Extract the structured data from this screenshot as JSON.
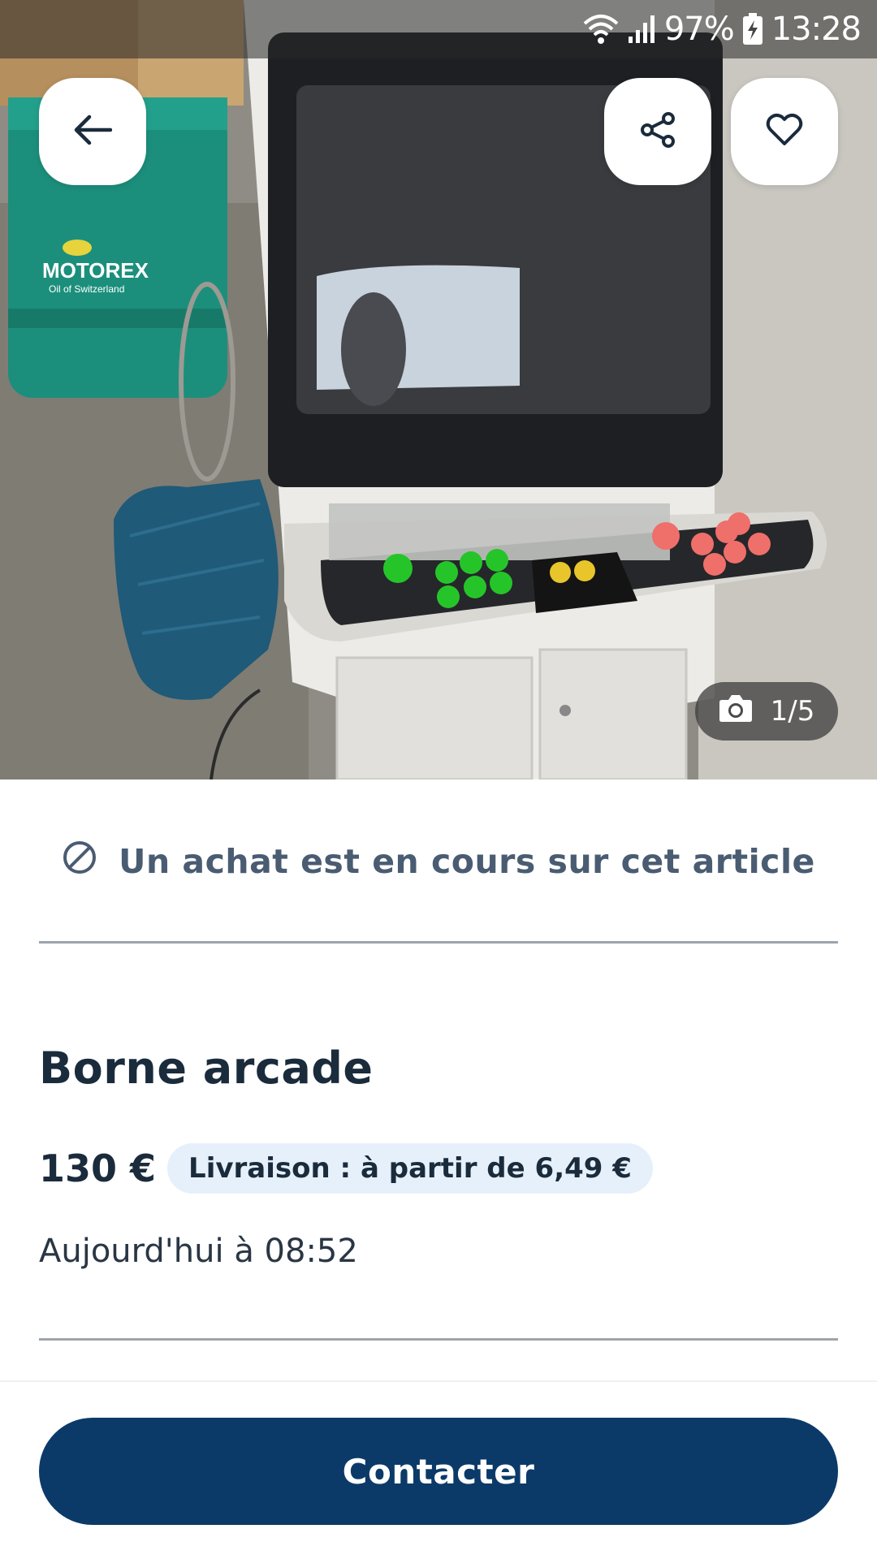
{
  "status_bar": {
    "battery": "97%",
    "time": "13:28",
    "icons": [
      "wifi-icon",
      "signal-icon",
      "battery-charging-icon"
    ]
  },
  "photo": {
    "counter": "1/5",
    "icons": [
      "camera-icon"
    ],
    "label_brand": "MOTOREX",
    "label_brand_sub": "Oil of Switzerland"
  },
  "actions": {
    "back_icon": "arrow-left-icon",
    "share_icon": "share-icon",
    "favorite_icon": "heart-icon"
  },
  "notice": {
    "icon": "blocked-icon",
    "text": "Un achat est en cours sur cet article"
  },
  "listing": {
    "title": "Borne arcade",
    "price": "130 €",
    "delivery": "Livraison : à partir de 6,49 €",
    "date": "Aujourd'hui à 08:52"
  },
  "footer": {
    "contact_label": "Contacter"
  },
  "colors": {
    "primary": "#0b3a68",
    "notice_text": "#4a5c72",
    "badge_bg": "#e6f0fb"
  }
}
